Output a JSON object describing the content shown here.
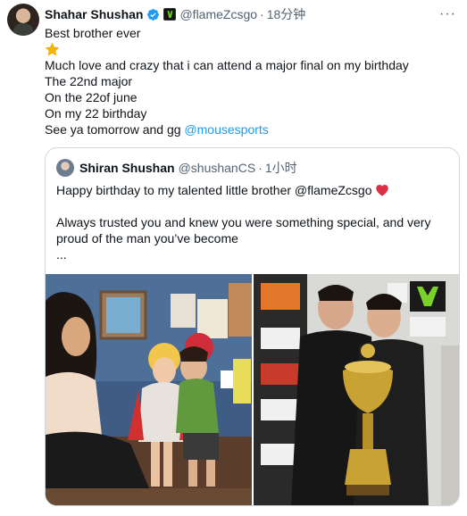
{
  "tweet": {
    "author_name": "Shahar Shushan",
    "handle": "@flameZcsgo",
    "separator": "·",
    "time": "18分钟",
    "more_label": "···",
    "lines": {
      "l1": "Best brother ever",
      "l3": "Much love and crazy that i can attend a major final on my birthday",
      "l4": "The 22nd major",
      "l5": "On the 22of june",
      "l6": "On my 22 birthday",
      "l7_prefix": "See ya tomorrow and gg "
    },
    "mention": "@mousesports",
    "star_emoji": "star-icon"
  },
  "quote": {
    "author_name": "Shiran Shushan",
    "handle": "@shushanCS",
    "separator": "·",
    "time": "1小时",
    "line1": "Happy birthday to my talented little brother @flameZcsgo",
    "line3": "Always trusted you and knew you were something special, and very",
    "line4": "proud of the man you’ve become",
    "line5": "...",
    "heart_emoji": "red-heart-icon"
  },
  "colors": {
    "link": "#1d9bf0",
    "secondary_text": "#536471",
    "border": "#cfd9de",
    "verified": "#1d9bf0"
  }
}
